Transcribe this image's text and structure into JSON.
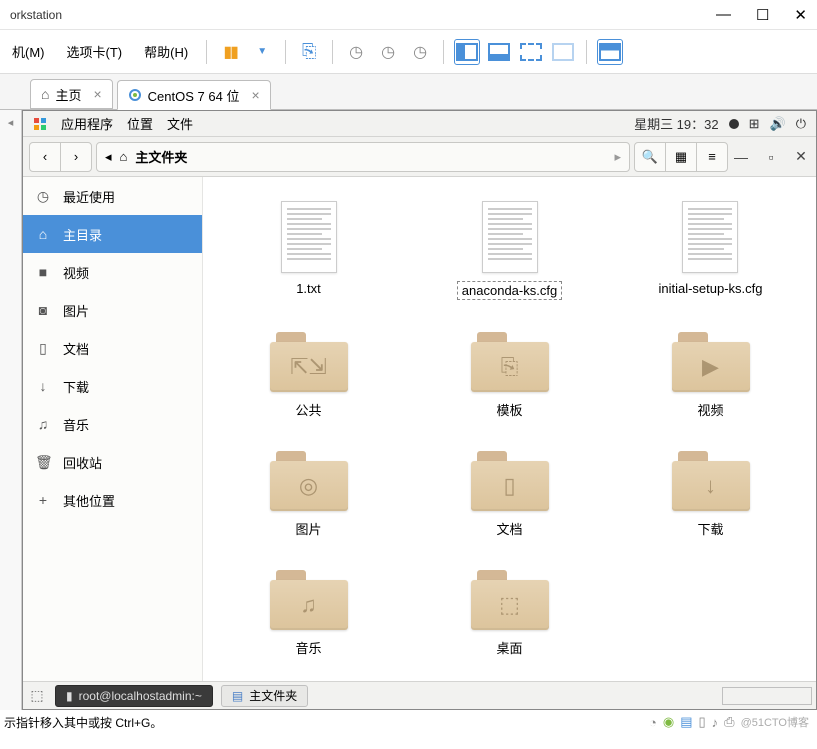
{
  "vm": {
    "title": "orkstation",
    "menus": {
      "machine": "机(M)",
      "tab": "选项卡(T)",
      "help": "帮助(H)"
    },
    "tabs": {
      "home": "主页",
      "guest": "CentOS 7 64 位"
    },
    "status_hint": "示指针移入其中或按 Ctrl+G。",
    "watermark": "@51CTO博客"
  },
  "gnome": {
    "apps_label": "应用程序",
    "places_label": "位置",
    "files_label": "文件",
    "clock": "星期三 19：32",
    "path_label": "主文件夹"
  },
  "sidebar": {
    "items": [
      {
        "label": "最近使用",
        "icon": "clock"
      },
      {
        "label": "主目录",
        "icon": "home",
        "active": true
      },
      {
        "label": "视频",
        "icon": "video"
      },
      {
        "label": "图片",
        "icon": "camera"
      },
      {
        "label": "文档",
        "icon": "doc"
      },
      {
        "label": "下载",
        "icon": "download"
      },
      {
        "label": "音乐",
        "icon": "music"
      },
      {
        "label": "回收站",
        "icon": "trash"
      },
      {
        "label": "其他位置",
        "icon": "plus"
      }
    ]
  },
  "files": {
    "items": [
      {
        "name": "1.txt",
        "type": "text"
      },
      {
        "name": "anaconda-ks.cfg",
        "type": "text",
        "selected": "outline"
      },
      {
        "name": "initial-setup-ks.cfg",
        "type": "text"
      },
      {
        "name": "公共",
        "type": "folder",
        "icon": "share"
      },
      {
        "name": "模板",
        "type": "folder",
        "icon": "template"
      },
      {
        "name": "视频",
        "type": "folder",
        "icon": "video"
      },
      {
        "name": "图片",
        "type": "folder",
        "icon": "camera"
      },
      {
        "name": "文档",
        "type": "folder",
        "icon": "doc"
      },
      {
        "name": "下载",
        "type": "folder",
        "icon": "download"
      },
      {
        "name": "音乐",
        "type": "folder",
        "icon": "music"
      },
      {
        "name": "桌面",
        "type": "folder",
        "icon": "desktop"
      }
    ]
  },
  "taskbar": {
    "terminal_label": "root@localhostadmin:~",
    "files_label": "主文件夹"
  }
}
